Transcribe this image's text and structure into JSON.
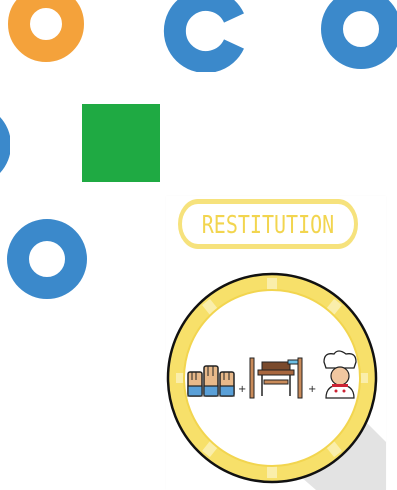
{
  "colors": {
    "orange": "#f4a23b",
    "blue": "#3b89cb",
    "green": "#1faa43",
    "yellow": "#f7e06a",
    "yellow_light": "#fbf0b3",
    "shadow": "#d6d6d6"
  },
  "shapes": [
    {
      "name": "orange-ring",
      "color": "orange"
    },
    {
      "name": "blue-c-shape",
      "color": "blue"
    },
    {
      "name": "blue-ring",
      "color": "blue"
    },
    {
      "name": "blue-ring-partial",
      "color": "blue"
    },
    {
      "name": "green-square",
      "color": "green"
    },
    {
      "name": "blue-ring",
      "color": "blue"
    }
  ],
  "card": {
    "title": "RESTITUTION",
    "icons": [
      "raised-hands-icon",
      "plus-icon",
      "table-icon",
      "plus-icon",
      "chef-icon"
    ]
  }
}
